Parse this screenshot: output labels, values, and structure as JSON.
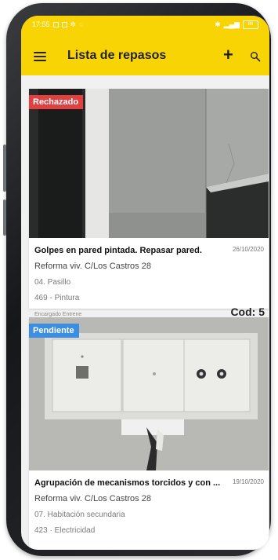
{
  "status_bar": {
    "time": "17:55",
    "battery": "86"
  },
  "appbar": {
    "title": "Lista de repasos",
    "accent": "#f9d405"
  },
  "cards": [
    {
      "badge": "Rechazado",
      "badge_color": "#e04040",
      "title": "Golpes en pared pintada. Repasar pared.",
      "date": "26/10/2020",
      "project": "Reforma viv. C/Los Castros 28",
      "room": "04. Pasillo",
      "trade": "469 - Pintura",
      "assignee": "Encargado Entrene",
      "code": "Cod: 5"
    },
    {
      "badge": "Pendiente",
      "badge_color": "#3b8ee0",
      "title": "Agrupación de mecanismos torcidos y con ...",
      "date": "19/10/2020",
      "project": "Reforma viv. C/Los Castros 28",
      "room": "07. Habitación secundaria",
      "trade": "423 · Electricidad"
    }
  ]
}
